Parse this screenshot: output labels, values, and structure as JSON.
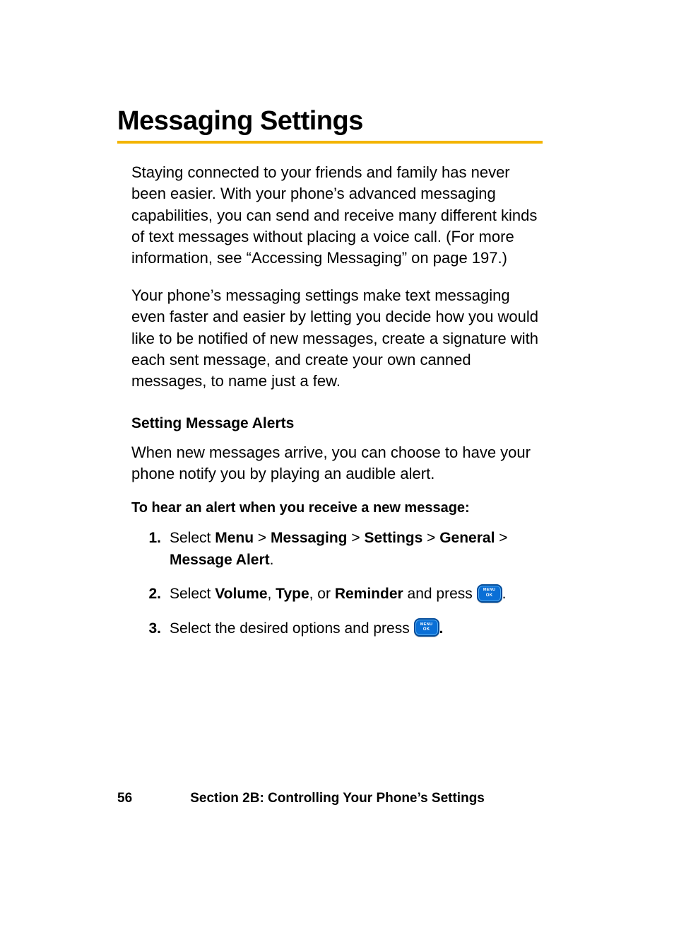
{
  "title": "Messaging Settings",
  "paragraphs": {
    "p1": "Staying connected to your friends and family has never been easier. With your phone’s advanced messaging capabilities, you can send and receive many different kinds of text messages without placing a voice call. (For more information, see “Accessing Messaging” on page 197.)",
    "p2": "Your phone’s messaging settings make text messaging even faster and easier by letting you decide how you would like to be notified of new messages, create a signature with each sent message, and create your own canned messages, to name just a few."
  },
  "sub_heading": "Setting Message Alerts",
  "sub_para": "When new messages arrive, you can choose to have your phone notify you by playing an audible alert.",
  "instruction": "To hear an alert when you receive a new message:",
  "steps": {
    "s1": {
      "num": "1.",
      "prefix": "Select ",
      "menu": "Menu",
      "sep": " > ",
      "messaging": "Messaging",
      "settings": "Settings",
      "general": "General",
      "alert": "Message Alert",
      "period": "."
    },
    "s2": {
      "num": "2.",
      "prefix": "Select ",
      "volume": "Volume",
      "comma": ", ",
      "type": "Type",
      "comma_or": ", or ",
      "reminder": "Reminder",
      "and_press": " and press ",
      "period": "."
    },
    "s3": {
      "num": "3.",
      "text": "Select the desired options and press ",
      "period": "."
    }
  },
  "menu_key": {
    "line1": "MENU",
    "line2": "OK"
  },
  "footer": {
    "page_num": "56",
    "section": "Section 2B: Controlling Your Phone’s Settings"
  }
}
